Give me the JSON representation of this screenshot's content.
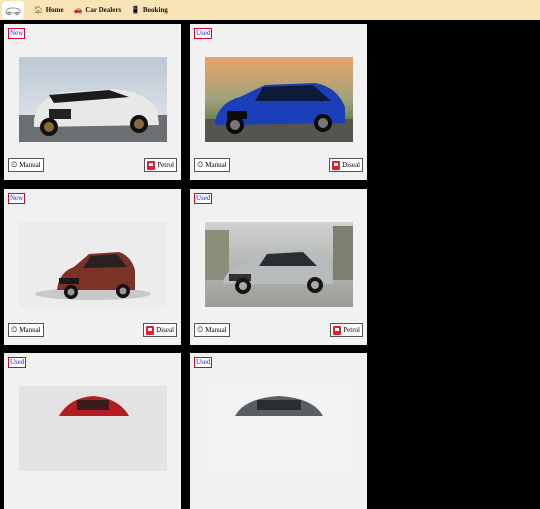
{
  "navbar": {
    "logo": "car-logo",
    "items": [
      {
        "icon": "home-icon",
        "label": "Home"
      },
      {
        "icon": "car-icon",
        "label": "Car Dealers"
      },
      {
        "icon": "phone-icon",
        "label": "Booking"
      }
    ]
  },
  "cards": [
    {
      "badge": "New",
      "transmission": "Manual",
      "fuel": "Petrol"
    },
    {
      "badge": "Used",
      "transmission": "Manual",
      "fuel": "Diseal"
    },
    {
      "badge": "New",
      "transmission": "Manual",
      "fuel": "Diseal"
    },
    {
      "badge": "Used",
      "transmission": "Manual",
      "fuel": "Petrol"
    },
    {
      "badge": "Used",
      "transmission": "",
      "fuel": ""
    },
    {
      "badge": "Used",
      "transmission": "",
      "fuel": ""
    }
  ],
  "colors": {
    "navbar": "#f8e4b6",
    "badge_border": "#e0002a",
    "badge_text": "#1a22d8",
    "fuel_icon": "#e02030"
  }
}
